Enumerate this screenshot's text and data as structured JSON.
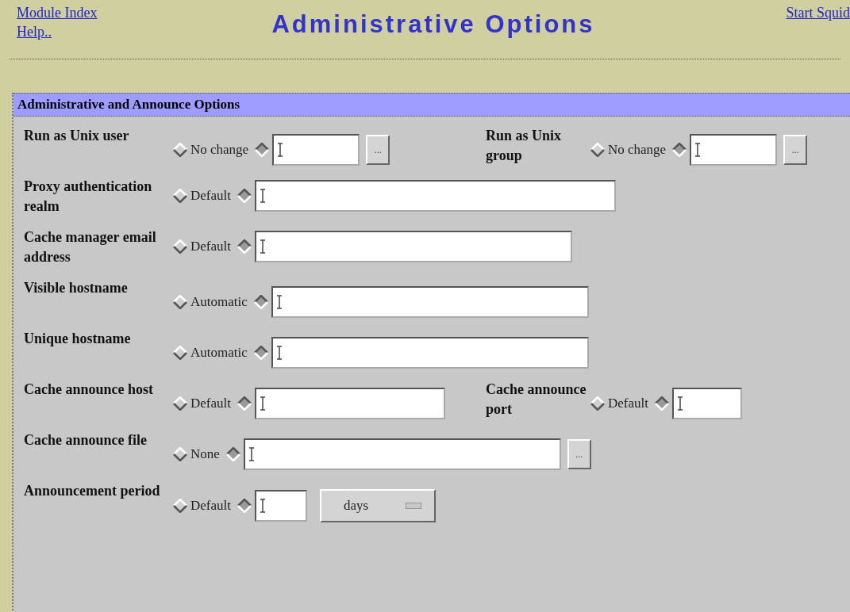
{
  "header": {
    "links_left": [
      "Module Index",
      "Help.."
    ],
    "title": "Administrative Options",
    "links_right": [
      "Start Squid"
    ]
  },
  "section": {
    "title": "Administrative and Announce Options",
    "rows": [
      {
        "fields": [
          {
            "label": "Run as Unix user",
            "default_label": "No change",
            "default_selected": false,
            "custom_selected": true,
            "browse": "..."
          },
          {
            "label": "Run as Unix group",
            "default_label": "No change",
            "default_selected": false,
            "custom_selected": true,
            "browse": "..."
          }
        ]
      },
      {
        "fields": [
          {
            "label": "Proxy authentication realm",
            "default_label": "Default",
            "default_selected": false,
            "custom_selected": true
          }
        ]
      },
      {
        "fields": [
          {
            "label": "Cache manager email address",
            "default_label": "Default",
            "default_selected": false,
            "custom_selected": true
          }
        ]
      },
      {
        "fields": [
          {
            "label": "Visible hostname",
            "default_label": "Automatic",
            "default_selected": false,
            "custom_selected": true
          }
        ]
      },
      {
        "fields": [
          {
            "label": "Unique hostname",
            "default_label": "Automatic",
            "default_selected": false,
            "custom_selected": true
          }
        ]
      },
      {
        "fields": [
          {
            "label": "Cache announce host",
            "default_label": "Default",
            "default_selected": false,
            "custom_selected": true
          },
          {
            "label": "Cache announce port",
            "default_label": "Default",
            "default_selected": false,
            "custom_selected": true
          }
        ]
      },
      {
        "fields": [
          {
            "label": "Cache announce file",
            "default_label": "None",
            "default_selected": false,
            "custom_selected": true,
            "browse": "..."
          }
        ]
      },
      {
        "fields": [
          {
            "label": "Announcement period",
            "default_label": "Default",
            "default_selected": false,
            "custom_selected": true,
            "unit": "days"
          }
        ]
      }
    ]
  }
}
